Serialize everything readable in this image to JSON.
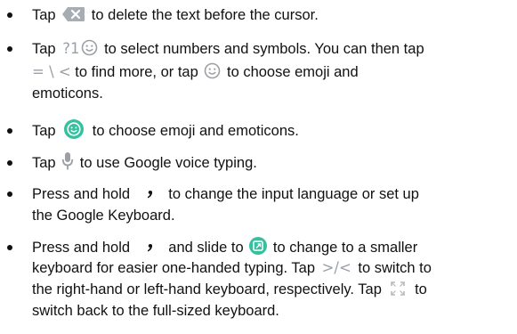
{
  "items": [
    {
      "lines": [
        {
          "before": "Tap",
          "icon": "backspace-icon",
          "after": "to delete the text before the cursor."
        }
      ]
    },
    {
      "lines": [
        {
          "before": "Tap",
          "icon_text": "?1",
          "icon": "smile-icon",
          "after": "to select numbers and symbols. You can then tap"
        },
        {
          "icon_text": "= \\ <",
          "mid": "to find more, or tap",
          "icon": "smile-icon",
          "after": "to choose emoji and"
        },
        {
          "text": "emoticons."
        }
      ]
    },
    {
      "lines": [
        {
          "before": "Tap",
          "icon": "emoji-button-icon",
          "after": "to choose emoji and emoticons."
        }
      ]
    },
    {
      "lines": [
        {
          "before": "Tap",
          "icon": "microphone-icon",
          "after": "to use Google voice typing."
        }
      ]
    },
    {
      "lines": [
        {
          "before": "Press and hold",
          "icon": "comma-key-icon",
          "after": "to change the input language or set up"
        },
        {
          "text": "the Google Keyboard."
        }
      ]
    },
    {
      "lines": [
        {
          "before": "Press and hold",
          "icon": "comma-key-icon",
          "mid": "and slide to",
          "icon2": "one-handed-mode-icon",
          "after": "to change to a smaller"
        },
        {
          "before": "keyboard for easier one-handed typing. Tap",
          "icon_text": ">/<",
          "after": "to switch to"
        },
        {
          "text": "the right-hand or left-hand keyboard, respectively. Tap",
          "icon": "expand-icon",
          "after": "to"
        },
        {
          "text": "switch back to the full-sized keyboard."
        }
      ]
    }
  ],
  "colors": {
    "icon_grey": "#9aa0a6",
    "emoji_green": "#35c0a0",
    "text": "#111111"
  }
}
